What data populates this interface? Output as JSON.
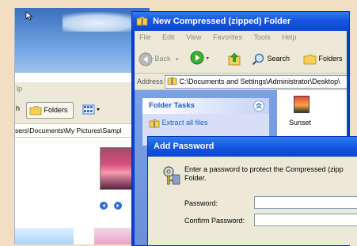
{
  "background_window": {
    "menu_fragment": "lp",
    "toolbar": {
      "back_fragment": "h",
      "folders_label": "Folders"
    },
    "address_text": "sers\\Documents\\My Pictures\\Sampl"
  },
  "main_window": {
    "title": "New Compressed (zipped) Folder",
    "menu": [
      "File",
      "Edit",
      "View",
      "Favorites",
      "Tools",
      "Help"
    ],
    "toolbar": {
      "back_label": "Back",
      "search_label": "Search",
      "folders_label": "Folders"
    },
    "address": {
      "label": "Address",
      "value": "C:\\Documents and Settings\\Administrator\\Desktop\\"
    },
    "folder_tasks": {
      "title": "Folder Tasks",
      "items": [
        "Extract all files"
      ]
    },
    "files": [
      {
        "name": "Sunset"
      }
    ]
  },
  "dialog": {
    "title": "Add Password",
    "message_line1": "Enter a password to protect the Compressed (zipp",
    "message_line2": "Folder.",
    "password_label": "Password:",
    "confirm_label": "Confirm Password:",
    "password_value": "",
    "confirm_value": ""
  },
  "colors": {
    "xp_title_blue": "#0a46d2",
    "task_pane_blue": "#6b8fd8",
    "dialog_face": "#ece9d8",
    "desktop_peach": "#f3ddc3"
  }
}
